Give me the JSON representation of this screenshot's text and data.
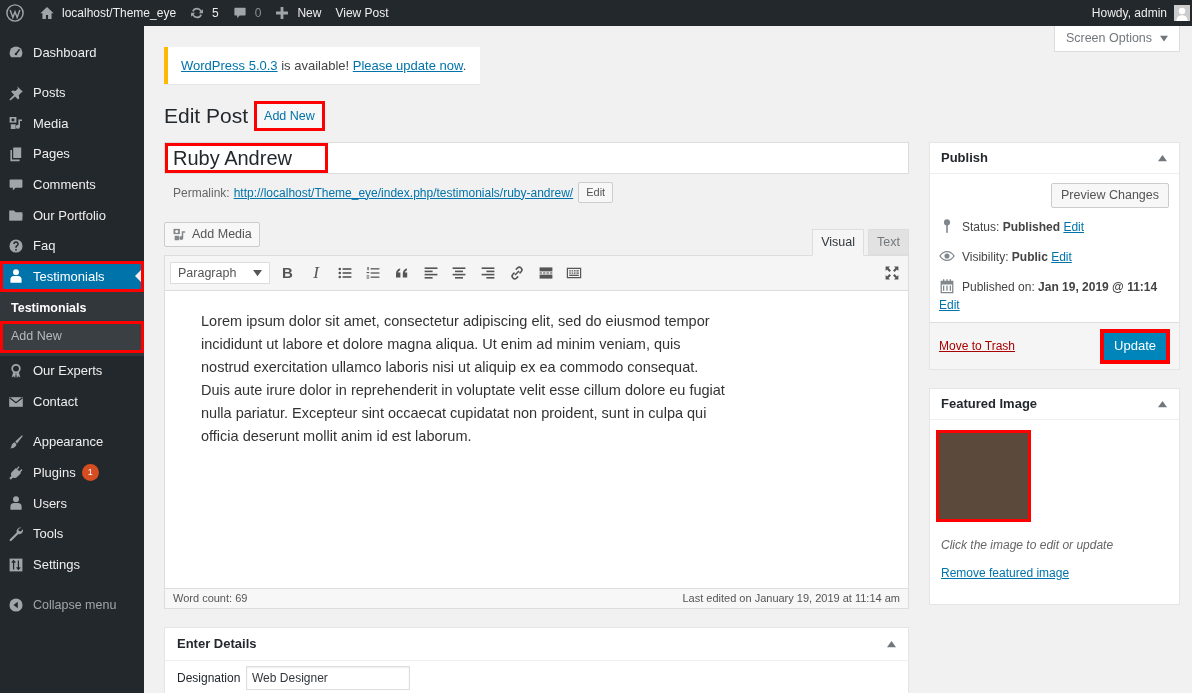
{
  "admin_bar": {
    "items": [
      {
        "kind": "site",
        "label": "localhost/Theme_eye"
      },
      {
        "kind": "updates",
        "label": "5"
      },
      {
        "kind": "comments",
        "label": "0"
      },
      {
        "kind": "new",
        "label": "New"
      },
      {
        "kind": "view",
        "label": "View Post"
      }
    ],
    "greeting": "Howdy, admin"
  },
  "sidebar": {
    "groups": [
      [
        {
          "kind": "dashboard",
          "label": "Dashboard",
          "selected": false,
          "highlighted": false
        }
      ],
      [
        {
          "kind": "posts",
          "label": "Posts",
          "selected": false,
          "highlighted": false
        },
        {
          "kind": "media",
          "label": "Media",
          "selected": false,
          "highlighted": false
        },
        {
          "kind": "pages",
          "label": "Pages",
          "selected": false,
          "highlighted": false
        },
        {
          "kind": "comments",
          "label": "Comments",
          "selected": false,
          "highlighted": false
        },
        {
          "kind": "portfolio",
          "label": "Our Portfolio",
          "selected": false,
          "highlighted": false
        },
        {
          "kind": "faq",
          "label": "Faq",
          "selected": false,
          "highlighted": false
        },
        {
          "kind": "testimonials",
          "label": "Testimonials",
          "selected": true,
          "highlighted": true,
          "children": [
            {
              "label": "Testimonials",
              "selected": true,
              "highlighted": false
            },
            {
              "label": "Add New",
              "selected": false,
              "highlighted": true
            }
          ]
        },
        {
          "kind": "experts",
          "label": "Our Experts",
          "selected": false,
          "highlighted": false
        },
        {
          "kind": "contact",
          "label": "Contact",
          "selected": false,
          "highlighted": false
        }
      ],
      [
        {
          "kind": "appearance",
          "label": "Appearance",
          "selected": false,
          "highlighted": false
        },
        {
          "kind": "plugins",
          "label": "Plugins",
          "badge": "1",
          "selected": false,
          "highlighted": false
        },
        {
          "kind": "users",
          "label": "Users",
          "selected": false,
          "highlighted": false
        },
        {
          "kind": "tools",
          "label": "Tools",
          "selected": false,
          "highlighted": false
        },
        {
          "kind": "settings",
          "label": "Settings",
          "selected": false,
          "highlighted": false
        }
      ]
    ],
    "collapse": {
      "label": "Collapse menu"
    }
  },
  "screen_options": {
    "label": "Screen Options"
  },
  "notice": {
    "version_link": "WordPress 5.0.3",
    "message": "is available!",
    "update_link": "Please update now",
    "end": "."
  },
  "heading": {
    "title": "Edit Post",
    "action": {
      "label": "Add New",
      "highlighted": true
    }
  },
  "title_field": {
    "value": "Ruby Andrew",
    "highlighted": true
  },
  "permalink": {
    "label": "Permalink:",
    "url": "http://localhost/Theme_eye/index.php/testimonials/ruby-andrew/",
    "edit_button": "Edit"
  },
  "editor": {
    "add_media": "Add Media",
    "tabs": [
      {
        "label": "Visual",
        "selected": true
      },
      {
        "label": "Text",
        "selected": false
      }
    ],
    "format": "Paragraph",
    "toolbar": [
      {
        "kind": "bold",
        "label": "B"
      },
      {
        "kind": "italic",
        "label": "I"
      },
      {
        "kind": "bullets"
      },
      {
        "kind": "numbers"
      },
      {
        "kind": "quote"
      },
      {
        "kind": "left"
      },
      {
        "kind": "center"
      },
      {
        "kind": "right"
      },
      {
        "kind": "link"
      },
      {
        "kind": "more"
      },
      {
        "kind": "toggle"
      },
      {
        "kind": "fullscreen"
      }
    ],
    "content": "Lorem ipsum dolor sit amet, consectetur adipiscing elit, sed do eiusmod tempor incididunt ut labore et dolore magna aliqua. Ut enim ad minim veniam, quis nostrud exercitation ullamco laboris nisi ut aliquip ex ea commodo consequat. Duis aute irure dolor in reprehenderit in voluptate velit esse cillum dolore eu fugiat nulla pariatur. Excepteur sint occaecat cupidatat non proident, sunt in culpa qui officia deserunt mollit anim id est laborum.",
    "word_count": "Word count: 69",
    "last_edited": "Last edited on January 19, 2019 at 11:14 am"
  },
  "details_box": {
    "title": "Enter Details",
    "fields": [
      {
        "label": "Designation",
        "value": "Web Designer"
      }
    ]
  },
  "publish_box": {
    "title": "Publish",
    "preview_button": "Preview Changes",
    "rows": [
      {
        "kind": "status",
        "text": "Status: **Published**",
        "link": "Edit"
      },
      {
        "kind": "visibility",
        "text": "Visibility: **Public**",
        "link": "Edit"
      },
      {
        "kind": "date",
        "text": "Published on: **Jan 19, 2019 @ 11:14**",
        "link": "Edit"
      }
    ],
    "trash_link": "Move to Trash",
    "update_button": {
      "label": "Update",
      "highlighted": true
    }
  },
  "featured_box": {
    "title": "Featured Image",
    "image": {
      "highlighted": true
    },
    "caption": "Click the image to edit or update",
    "remove_link": "Remove featured image"
  }
}
